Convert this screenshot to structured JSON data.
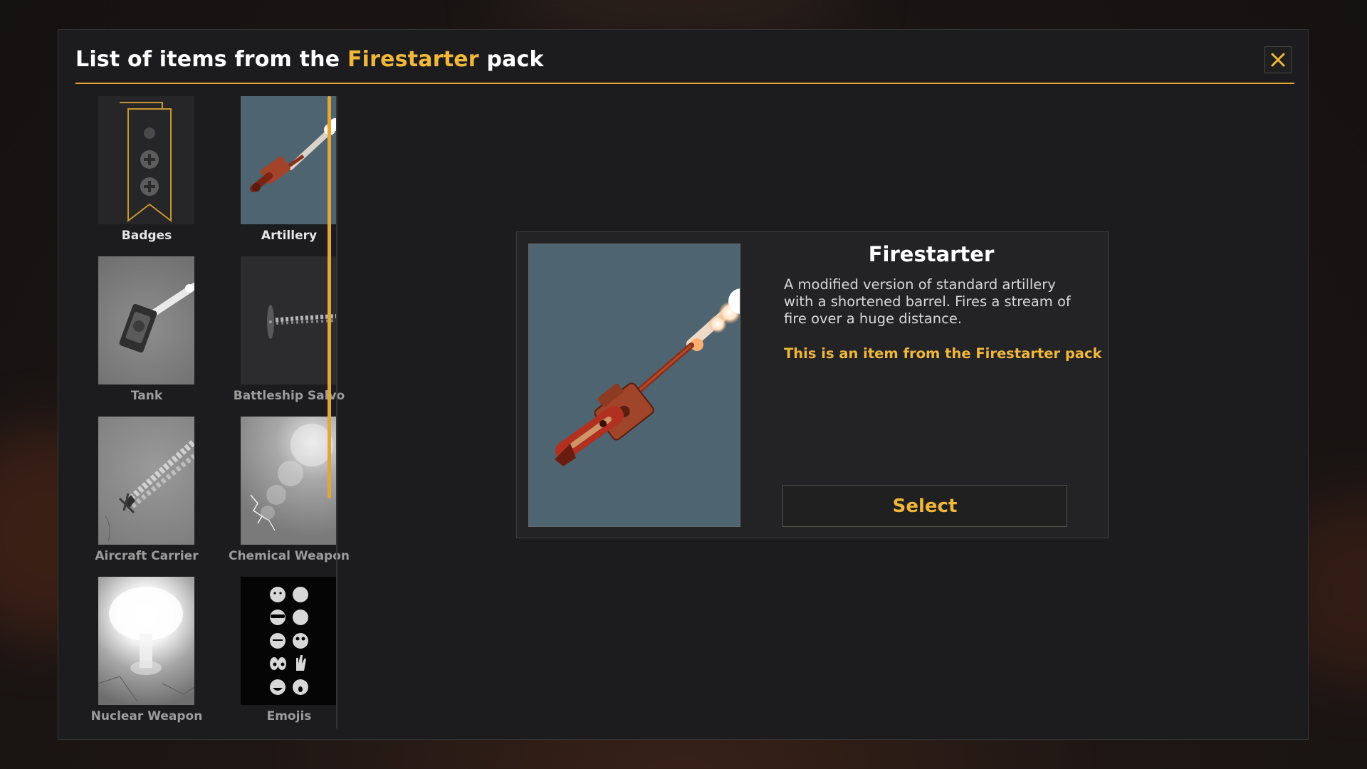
{
  "modal": {
    "title_prefix": "List of items from the",
    "title_pack": "Firestarter",
    "title_suffix": "pack",
    "close_icon": "close-icon"
  },
  "items": [
    {
      "label": "Badges",
      "icon": "badges-icon",
      "active": true
    },
    {
      "label": "Artillery",
      "icon": "artillery-icon",
      "active": true
    },
    {
      "label": "Tank",
      "icon": "tank-icon",
      "active": false
    },
    {
      "label": "Battleship Salvo",
      "icon": "battleship-salvo-icon",
      "active": false
    },
    {
      "label": "Aircraft Carrier",
      "icon": "aircraft-carrier-icon",
      "active": false
    },
    {
      "label": "Chemical Weapon",
      "icon": "chemical-weapon-icon",
      "active": false
    },
    {
      "label": "Nuclear Weapon",
      "icon": "nuclear-weapon-icon",
      "active": false
    },
    {
      "label": "Emojis",
      "icon": "emojis-icon",
      "active": false
    }
  ],
  "detail": {
    "title": "Firestarter",
    "description": "A modified version of standard artillery with a shortened barrel. Fires a stream of fire over a huge distance.",
    "pack_note": "This is an item from the Firestarter pack",
    "select_label": "Select",
    "preview_icon": "firestarter-artillery-icon"
  },
  "colors": {
    "accent": "#f1b73b",
    "background": "#1c1c1e",
    "preview_bg": "#4e6470"
  }
}
